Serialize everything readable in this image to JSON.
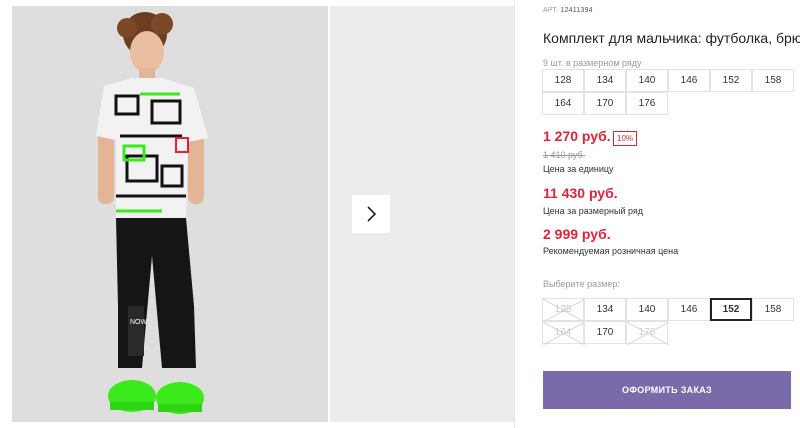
{
  "product": {
    "art_label": "АРТ.",
    "art_number": "12411394",
    "title": "Комплект для мальчика: футболка, брюки"
  },
  "size_range": {
    "label": "9 шт. в размерном ряду",
    "sizes": [
      "128",
      "134",
      "140",
      "146",
      "152",
      "158",
      "164",
      "170",
      "176"
    ]
  },
  "prices": {
    "unit_price": "1 270 руб.",
    "discount": "10%",
    "old_price": "1 410 руб.",
    "unit_caption": "Цена за единицу",
    "range_price": "11 430 руб.",
    "range_caption": "Цена за размерный ряд",
    "retail_price": "2 999 руб.",
    "retail_caption": "Рекомендуемая розничная цена"
  },
  "size_select": {
    "label": "Выберите размер:",
    "options": [
      {
        "size": "128",
        "available": false,
        "selected": false
      },
      {
        "size": "134",
        "available": true,
        "selected": false
      },
      {
        "size": "140",
        "available": true,
        "selected": false
      },
      {
        "size": "146",
        "available": true,
        "selected": false
      },
      {
        "size": "152",
        "available": true,
        "selected": true
      },
      {
        "size": "158",
        "available": true,
        "selected": false
      },
      {
        "size": "164",
        "available": false,
        "selected": false
      },
      {
        "size": "170",
        "available": true,
        "selected": false
      },
      {
        "size": "176",
        "available": false,
        "selected": false
      }
    ]
  },
  "order_button": {
    "label": "ОФОРМИТЬ ЗАКАЗ"
  },
  "colors": {
    "price_red": "#e3223a",
    "button_purple": "#7b6aa9",
    "shoe_green": "#3bea1a"
  },
  "icons": {
    "next": "chevron-right-icon"
  }
}
